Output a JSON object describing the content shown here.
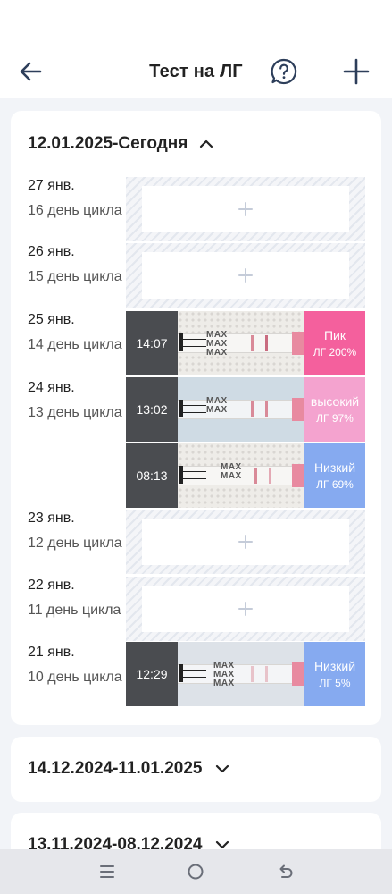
{
  "header": {
    "title": "Тест на ЛГ",
    "back_icon": "arrow-left-icon",
    "help_icon": "question-bubble-icon",
    "add_icon": "plus-icon"
  },
  "current_period": {
    "title": "12.01.2025-Сегодня",
    "expanded": true,
    "days": [
      {
        "date": "27 янв.",
        "cycle": "16 день цикла",
        "tests": []
      },
      {
        "date": "26 янв.",
        "cycle": "15 день цикла",
        "tests": []
      },
      {
        "date": "25 янв.",
        "cycle": "14 день цикла",
        "tests": [
          {
            "time": "14:07",
            "level": "Пик",
            "value": "ЛГ 200%",
            "color": "#f4609d"
          }
        ]
      },
      {
        "date": "24 янв.",
        "cycle": "13 день цикла",
        "tests": [
          {
            "time": "13:02",
            "level": "высокий",
            "value": "ЛГ 97%",
            "color": "#f4a3cf"
          },
          {
            "time": "08:13",
            "level": "Низкий",
            "value": "ЛГ 69%",
            "color": "#86aaf0"
          }
        ]
      },
      {
        "date": "23 янв.",
        "cycle": "12 день цикла",
        "tests": []
      },
      {
        "date": "22 янв.",
        "cycle": "11 день цикла",
        "tests": []
      },
      {
        "date": "21 янв.",
        "cycle": "10 день цикла",
        "tests": [
          {
            "time": "12:29",
            "level": "Низкий",
            "value": "ЛГ 5%",
            "color": "#86aaf0"
          }
        ]
      }
    ]
  },
  "strip_text": "MAX",
  "previous_periods": [
    {
      "title": "14.12.2024-11.01.2025",
      "expanded": false
    },
    {
      "title": "13.11.2024-08.12.2024",
      "expanded": false
    }
  ],
  "nav": {
    "menu_icon": "menu-lines-icon",
    "home_icon": "home-circle-icon",
    "back_icon": "back-arrow-icon"
  }
}
